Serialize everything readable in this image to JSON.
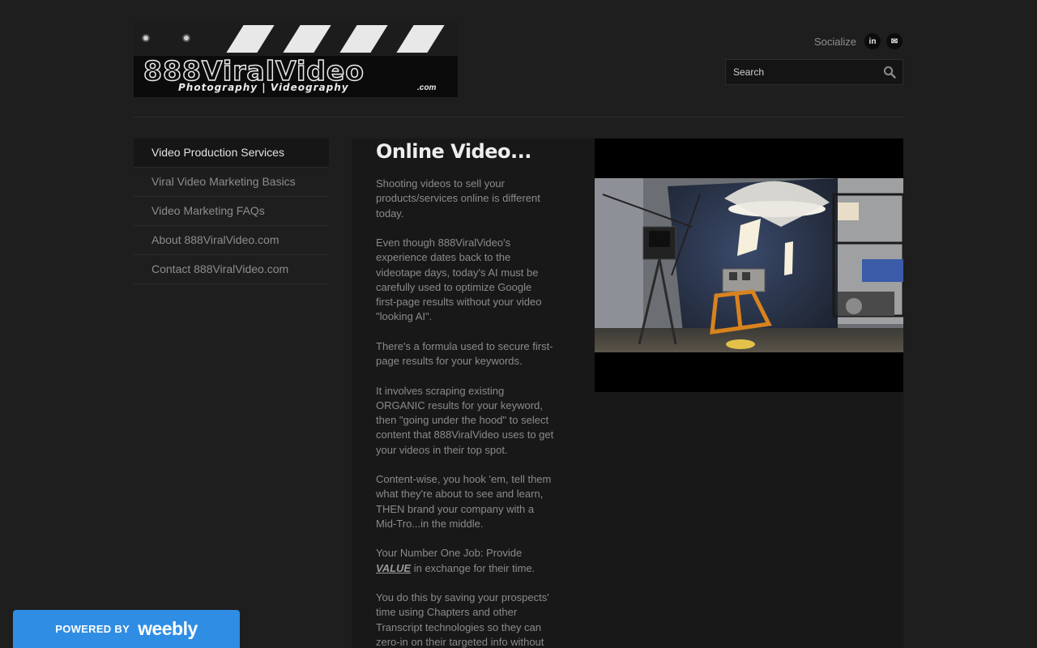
{
  "header": {
    "logo_brand": "888ViralVideo",
    "logo_tagline": "Photography | Videography",
    "logo_dotcom": ".com",
    "socialize_label": "Socialize",
    "social_icons": [
      "linkedin-icon",
      "mail-icon"
    ],
    "linkedin_glyph": "in",
    "mail_glyph": "✉",
    "search_placeholder": "Search"
  },
  "nav": {
    "items": [
      {
        "label": "Video Production Services",
        "active": true
      },
      {
        "label": "Viral Video Marketing Basics",
        "active": false
      },
      {
        "label": "Video Marketing FAQs",
        "active": false
      },
      {
        "label": "About 888ViralVideo.com",
        "active": false
      },
      {
        "label": "Contact 888ViralVideo.com",
        "active": false
      }
    ]
  },
  "main": {
    "title": "Online Video...",
    "paragraphs": [
      "Shooting videos to sell your products/services online is different today.",
      "Even though 888ViralVideo's experience dates back to the videotape days, today's AI must be carefully used to optimize Google first-page results without your video \"looking AI\".",
      "There's a formula used to secure first-page results for your keywords.",
      "It involves scraping existing ORGANIC results for your keyword, then \"going under the hood\" to select content that 888ViralVideo uses to get your videos in their top spot.",
      "Content-wise, you hook 'em, tell them what they're about to see and learn, THEN brand your company with a Mid-Tro...in the middle."
    ],
    "job_prefix": "Your Number One Job: Provide",
    "job_value": "VALUE",
    "job_suffix": " in exchange for their time.",
    "last_paragraph": "You do this by saving your prospects' time using Chapters and other Transcript technologies so they can zero-in on their targeted info without"
  },
  "badge": {
    "powered_by": "POWERED BY",
    "brand": "weebly"
  },
  "colors": {
    "page_bg": "#1e1e1f",
    "content_bg": "#181818",
    "weebly_blue": "#2f8de4",
    "title_text": "#eeeeee",
    "body_text": "#8b8b8b"
  }
}
